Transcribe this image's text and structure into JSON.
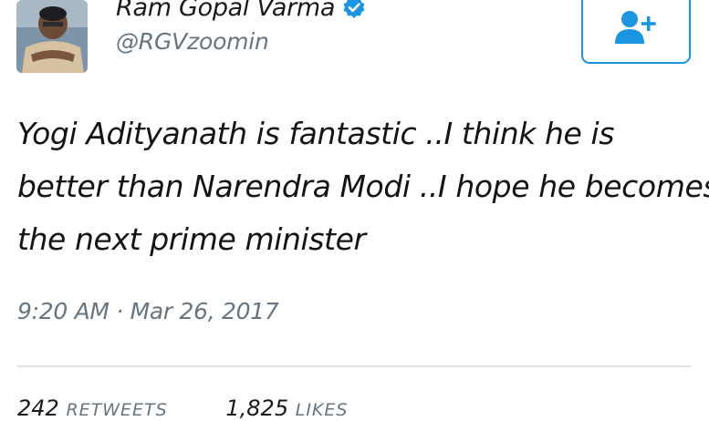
{
  "user": {
    "display_name": "Ram Gopal Varma",
    "handle": "@RGVzoomin",
    "avatar_icon": "profile-photo",
    "verified_icon": "verified-badge-icon"
  },
  "follow_button": {
    "icon": "add-user-icon",
    "color": "#1b95e0"
  },
  "tweet": {
    "lines": [
      "Yogi Adityanath is fantastic ..I think he is",
      "better than Narendra Modi ..I hope he becomes",
      "the next prime minister"
    ],
    "timestamp": "9:20 AM · Mar 26, 2017"
  },
  "stats": {
    "retweets_count": "242",
    "retweets_label": "RETWEETS",
    "likes_count": "1,825",
    "likes_label": "LIKES"
  },
  "colors": {
    "accent": "#1b95e0",
    "secondary_text": "#66757f"
  }
}
